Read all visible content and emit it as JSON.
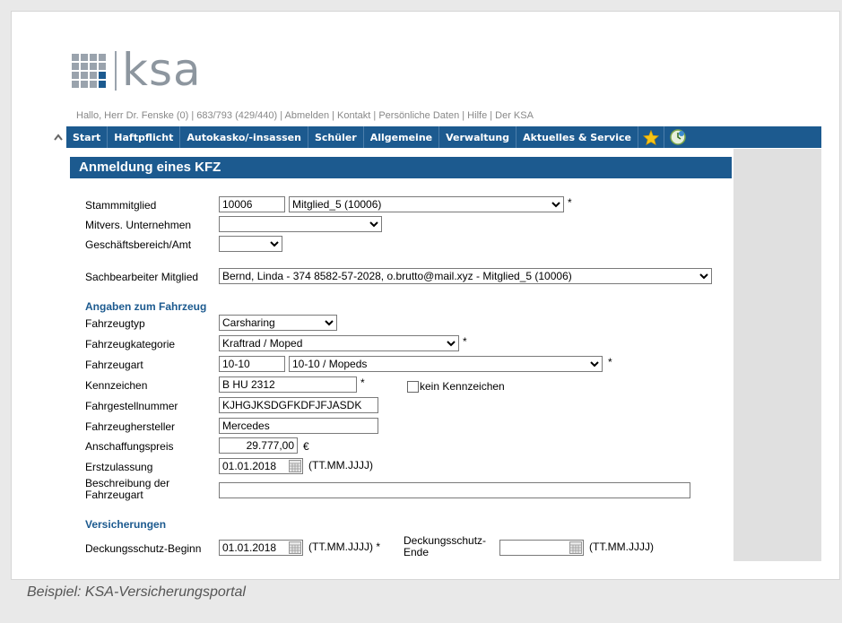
{
  "logo": {
    "word": "ksa"
  },
  "userline": "Hallo, Herr Dr. Fenske (0) | 683/793 (429/440) | Abmelden | Kontakt | Persönliche Daten | Hilfe | Der KSA",
  "nav": {
    "collapse_icon": "chevron-up-icon",
    "items": [
      "Start",
      "Haftpflicht",
      "Autokasko/-insassen",
      "Schüler",
      "Allgemeine",
      "Verwaltung",
      "Aktuelles & Service"
    ],
    "star_icon": "star-icon",
    "clock_icon": "clock-icon"
  },
  "panel": {
    "title": "Anmeldung eines KFZ"
  },
  "form": {
    "stammmitglied": {
      "label": "Stammmitglied",
      "id_value": "10006",
      "select_value": "Mitglied_5 (10006)",
      "required": "*"
    },
    "mitvers": {
      "label": "Mitvers. Unternehmen",
      "select_value": ""
    },
    "geschaeftsbereich": {
      "label": "Geschäftsbereich/Amt",
      "select_value": ""
    },
    "sachbearbeiter": {
      "label": "Sachbearbeiter Mitglied",
      "select_value": "Bernd, Linda - 374 8582-57-2028, o.brutto@mail.xyz - Mitglied_5 (10006)"
    },
    "section_fahrzeug": "Angaben zum Fahrzeug",
    "fahrzeugtyp": {
      "label": "Fahrzeugtyp",
      "select_value": "Carsharing"
    },
    "fahrzeugkategorie": {
      "label": "Fahrzeugkategorie",
      "select_value": "Kraftrad / Moped",
      "required": "*"
    },
    "fahrzeugart": {
      "label": "Fahrzeugart",
      "code_value": "10-10",
      "select_value": "10-10 / Mopeds",
      "required": "*"
    },
    "kennzeichen": {
      "label": "Kennzeichen",
      "value": "B HU 2312",
      "required": "*",
      "checkbox_label": "kein Kennzeichen"
    },
    "fahrgestellnummer": {
      "label": "Fahrgestellnummer",
      "value": "KJHGJKSDGFKDFJFJASDK"
    },
    "hersteller": {
      "label": "Fahrzeughersteller",
      "value": "Mercedes"
    },
    "anschaffungspreis": {
      "label": "Anschaffungspreis",
      "value": "29.777,00",
      "unit": "€"
    },
    "erstzulassung": {
      "label": "Erstzulassung",
      "value": "01.01.2018",
      "hint": "(TT.MM.JJJJ)"
    },
    "beschreibung": {
      "label_1": "Beschreibung der",
      "label_2": "Fahrzeugart",
      "value": ""
    },
    "section_versicherungen": "Versicherungen",
    "beginn": {
      "label": "Deckungsschutz-Beginn",
      "value": "01.01.2018",
      "hint": "(TT.MM.JJJJ) *"
    },
    "ende": {
      "label_1": "Deckungsschutz-",
      "label_2": "Ende",
      "value": "",
      "hint": "(TT.MM.JJJJ)"
    }
  },
  "caption": "Beispiel: KSA-Versicherungsportal"
}
